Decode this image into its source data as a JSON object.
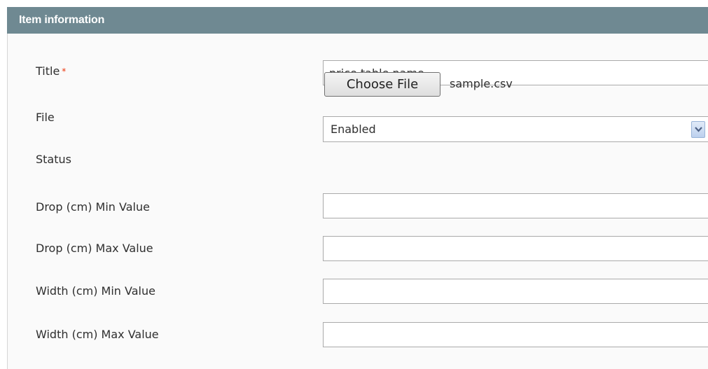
{
  "header": {
    "title": "Item information"
  },
  "form": {
    "title": {
      "label": "Title",
      "required_mark": "*",
      "value": "price table name"
    },
    "file": {
      "label": "File",
      "button_label": "Choose File",
      "file_name": "sample.csv"
    },
    "status": {
      "label": "Status",
      "selected": "Enabled"
    },
    "drop_min": {
      "label": "Drop (cm) Min Value",
      "value": ""
    },
    "drop_max": {
      "label": "Drop (cm) Max Value",
      "value": ""
    },
    "width_min": {
      "label": "Width (cm) Min Value",
      "value": ""
    },
    "width_max": {
      "label": "Width (cm) Max Value",
      "value": ""
    }
  },
  "colors": {
    "header_bg": "#6f8992",
    "required": "#eb340a"
  },
  "icons": {
    "select_arrow": "chevron-down-icon"
  }
}
